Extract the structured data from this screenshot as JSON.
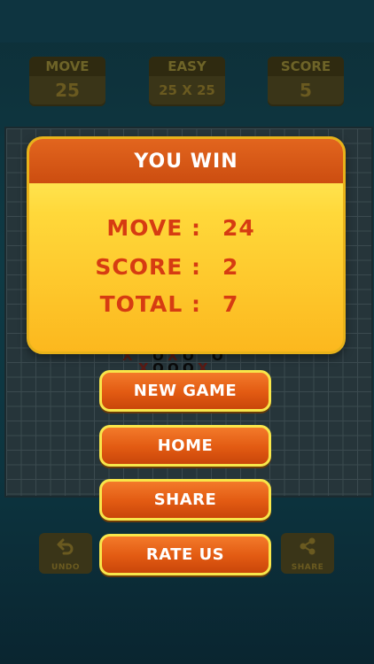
{
  "stats": {
    "move_label": "MOVE",
    "move_value": "25",
    "difficulty_label": "EASY",
    "difficulty_value": "25 X 25",
    "score_label": "SCORE",
    "score_value": "5"
  },
  "popup": {
    "title": "YOU WIN",
    "move_label": "MOVE :",
    "move_value": "24",
    "score_label": "SCORE :",
    "score_value": "2",
    "total_label": "TOTAL :",
    "total_value": "7"
  },
  "buttons": {
    "new_game": "NEW GAME",
    "home": "HOME",
    "share": "SHARE",
    "rate_us": "RATE US"
  },
  "toolbar": {
    "undo_label": "UNDO",
    "share_label": "SHARE"
  },
  "board_marks": [
    "X",
    "O",
    "X",
    "O",
    "O",
    "X",
    "O",
    "O",
    "O",
    "X"
  ],
  "colors": {
    "popup_header": "#cc4d10",
    "popup_body": "#ffd83a",
    "popup_text": "#d63c12",
    "button_fill": "#e25a12",
    "button_border": "#f8e64a"
  },
  "icons": {
    "undo": "undo-arrow-icon",
    "share": "share-icon"
  }
}
